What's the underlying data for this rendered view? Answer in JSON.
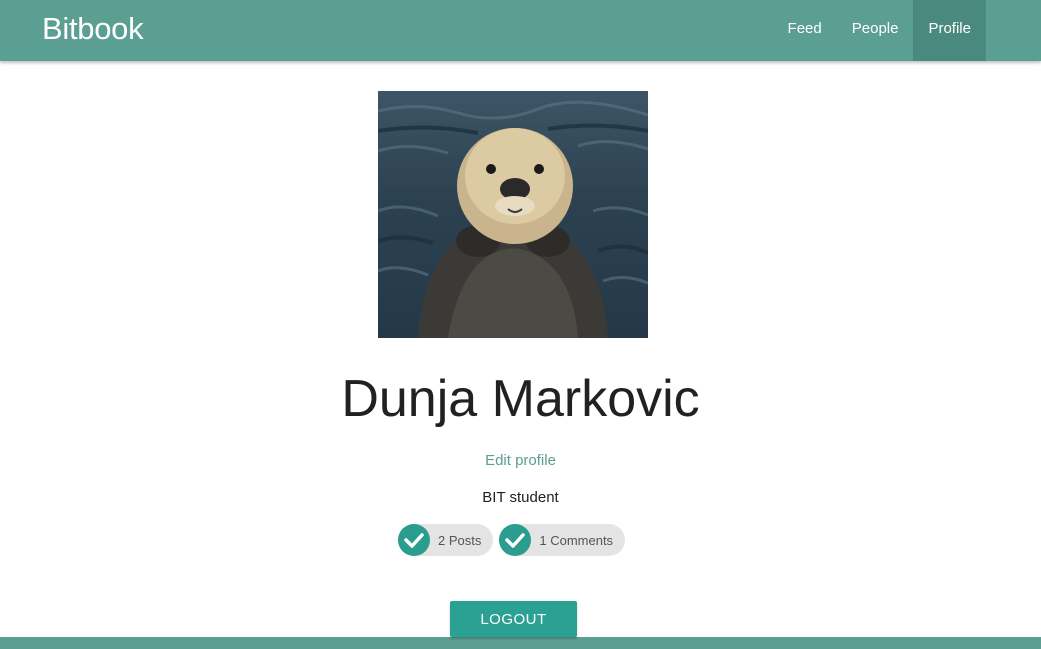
{
  "navbar": {
    "brand": "Bitbook",
    "links": [
      {
        "label": "Feed"
      },
      {
        "label": "People"
      },
      {
        "label": "Profile",
        "active": true
      }
    ]
  },
  "profile": {
    "avatar_icon": "sea-otter-photo",
    "name": "Dunja Markovic",
    "edit_label": "Edit profile",
    "about": "BIT student",
    "stats": [
      {
        "icon": "check-icon",
        "label": "2 Posts"
      },
      {
        "icon": "check-icon",
        "label": "1 Comments"
      }
    ]
  },
  "actions": {
    "logout_label": "LOGOUT"
  },
  "colors": {
    "primary": "#5b9e92",
    "active_tab": "#4a8a7e",
    "accent": "#2aa193",
    "chip_bg": "#e4e4e4"
  }
}
